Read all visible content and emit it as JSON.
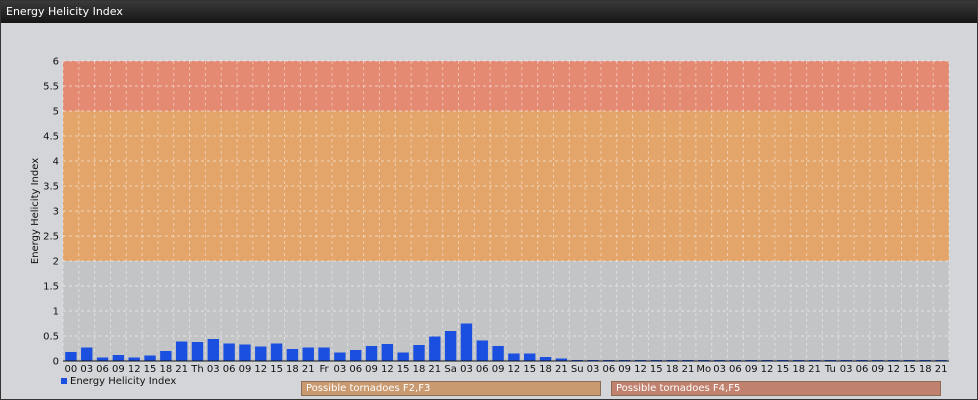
{
  "window": {
    "title": "Energy Helicity Index"
  },
  "colors": {
    "bar": "#1a4fe0",
    "zone_low": "#c3c4c6",
    "zone_mid": "#e3a56a",
    "zone_high": "#e48a72",
    "zone_mid_box": "#c99a70",
    "zone_high_box": "#c0816e"
  },
  "legend": {
    "series_label": "Energy Helicity Index"
  },
  "zones": [
    {
      "label": "Possible tornadoes F2,F3",
      "from": 2,
      "to": 5
    },
    {
      "label": "Possible tornadoes F4,F5",
      "from": 5,
      "to": 6
    }
  ],
  "chart_data": {
    "type": "bar",
    "ylabel": "Energy Helicity Index",
    "ylim": [
      0,
      6
    ],
    "yticks": [
      "0",
      "0.5",
      "1",
      "1.5",
      "2",
      "2.5",
      "3",
      "3.5",
      "4",
      "4.5",
      "5",
      "5.5",
      "6"
    ],
    "grid": true,
    "legend_position": "bottom-left",
    "categories": [
      "00",
      "03",
      "06",
      "09",
      "12",
      "15",
      "18",
      "21",
      "Th",
      "03",
      "06",
      "09",
      "12",
      "15",
      "18",
      "21",
      "Fr",
      "03",
      "06",
      "09",
      "12",
      "15",
      "18",
      "21",
      "Sa",
      "03",
      "06",
      "09",
      "12",
      "15",
      "18",
      "21",
      "Su",
      "03",
      "06",
      "09",
      "12",
      "15",
      "18",
      "21",
      "Mo",
      "03",
      "06",
      "09",
      "12",
      "15",
      "18",
      "21",
      "Tu",
      "03",
      "06",
      "09",
      "12",
      "15",
      "18",
      "21"
    ],
    "series": [
      {
        "name": "Energy Helicity Index",
        "values": [
          0.18,
          0.27,
          0.07,
          0.12,
          0.07,
          0.11,
          0.2,
          0.39,
          0.38,
          0.44,
          0.35,
          0.33,
          0.29,
          0.35,
          0.24,
          0.27,
          0.27,
          0.17,
          0.22,
          0.3,
          0.34,
          0.17,
          0.32,
          0.49,
          0.6,
          0.75,
          0.41,
          0.3,
          0.15,
          0.15,
          0.08,
          0.05,
          0.02,
          0.01,
          0.01,
          0.01,
          0.01,
          0.01,
          0.01,
          0.01,
          0.01,
          0.01,
          0.01,
          0.01,
          0.01,
          0.01,
          0.01,
          0.01,
          0.01,
          0.01,
          0.01,
          0.01,
          0.01,
          0.01,
          0.01,
          0.01
        ]
      }
    ]
  }
}
